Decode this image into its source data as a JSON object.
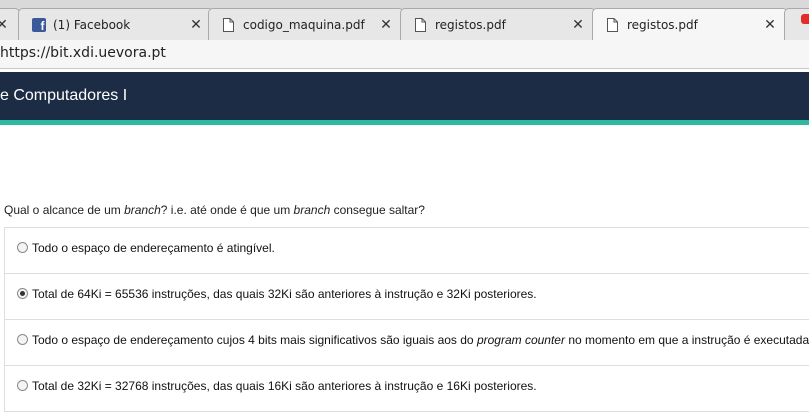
{
  "browser": {
    "tabs": [
      {
        "title": "",
        "icon": "generic-page-icon",
        "active": false
      },
      {
        "title": "(1) Facebook",
        "icon": "facebook-icon",
        "active": false
      },
      {
        "title": "codigo_maquina.pdf",
        "icon": "document-icon",
        "active": false
      },
      {
        "title": "registos.pdf",
        "icon": "document-icon",
        "active": false
      },
      {
        "title": "registos.pdf",
        "icon": "document-icon",
        "active": true
      },
      {
        "title": "",
        "icon": "youtube-icon",
        "active": false
      }
    ],
    "close_glyph": "✕",
    "url": "https://bit.xdi.uevora.pt"
  },
  "site": {
    "title": "e Computadores I",
    "header_color": "#1c2c45",
    "accent_color": "#2db89f"
  },
  "question": {
    "prefix": "Qual o alcance de um ",
    "em1": "branch",
    "middle": "? i.e. até onde é que um ",
    "em2": "branch",
    "suffix": " consegue saltar?"
  },
  "answers": [
    {
      "checked": false,
      "text": "Todo o espaço de endereçamento é atingível."
    },
    {
      "checked": true,
      "text": "Total de 64Ki = 65536 instruções, das quais 32Ki são anteriores à instrução e 32Ki posteriores."
    },
    {
      "checked": false,
      "text_before": "Todo o espaço de endereçamento cujos 4 bits mais significativos são iguais aos do ",
      "text_em": "program counter",
      "text_after": " no momento em que a instrução é executada."
    },
    {
      "checked": false,
      "text": "Total de 32Ki = 32768 instruções, das quais 16Ki são anteriores à instrução e 16Ki posteriores."
    }
  ]
}
